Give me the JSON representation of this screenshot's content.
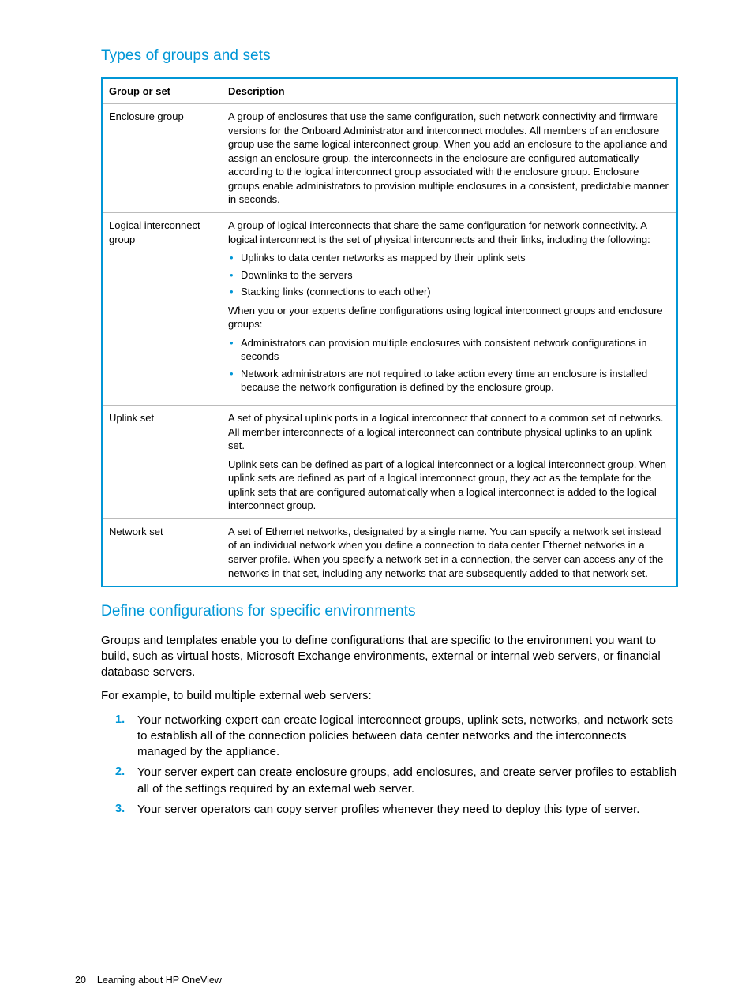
{
  "headings": {
    "h1": "Types of groups and sets",
    "h2": "Define configurations for specific environments"
  },
  "table": {
    "headers": [
      "Group or set",
      "Description"
    ],
    "rows": [
      {
        "name": "Enclosure group",
        "desc_p1": "A group of enclosures that use the same configuration, such network connectivity and firmware versions for the Onboard Administrator and interconnect modules. All members of an enclosure group use the same logical interconnect group. When you add an enclosure to the appliance and assign an enclosure group, the interconnects in the enclosure are configured automatically according to the logical interconnect group associated with the enclosure group. Enclosure groups enable administrators to provision multiple enclosures in a consistent, predictable manner in seconds."
      },
      {
        "name": "Logical interconnect group",
        "desc_p1": "A group of logical interconnects that share the same configuration for network connectivity. A logical interconnect is the set of physical interconnects and their links, including the following:",
        "bullets1": [
          "Uplinks to data center networks as mapped by their uplink sets",
          "Downlinks to the servers",
          "Stacking links (connections to each other)"
        ],
        "desc_p2": "When you or your experts define configurations using logical interconnect groups and enclosure groups:",
        "bullets2": [
          "Administrators can provision multiple enclosures with consistent network configurations in seconds",
          "Network administrators are not required to take action every time an enclosure is installed because the network configuration is defined by the enclosure group."
        ]
      },
      {
        "name": "Uplink set",
        "desc_p1": "A set of physical uplink ports in a logical interconnect that connect to a common set of networks. All member interconnects of a logical interconnect can contribute physical uplinks to an uplink set.",
        "desc_p2": "Uplink sets can be defined as part of a logical interconnect or a logical interconnect group. When uplink sets are defined as part of a logical interconnect group, they act as the template for the uplink sets that are configured automatically when a logical interconnect is added to the logical interconnect group."
      },
      {
        "name": "Network set",
        "desc_p1": "A set of Ethernet networks, designated by a single name. You can specify a network set instead of an individual network when you define a connection to data center Ethernet networks in a server profile. When you specify a network set in a connection, the server can access any of the networks in that set, including any networks that are subsequently added to that network set."
      }
    ]
  },
  "body": {
    "p1": "Groups and templates enable you to define configurations that are specific to the environment you want to build, such as virtual hosts, Microsoft Exchange environments, external or internal web servers, or financial database servers.",
    "p2": "For example, to build multiple external web servers:",
    "steps": [
      "Your networking expert can create logical interconnect groups, uplink sets, networks, and network sets to establish all of the connection policies between data center networks and the interconnects managed by the appliance.",
      "Your server expert can create enclosure groups, add enclosures, and create server profiles to establish all of the settings required by an external web server.",
      "Your server operators can copy server profiles whenever they need to deploy this type of server."
    ]
  },
  "footer": {
    "page": "20",
    "title": "Learning about HP OneView"
  }
}
